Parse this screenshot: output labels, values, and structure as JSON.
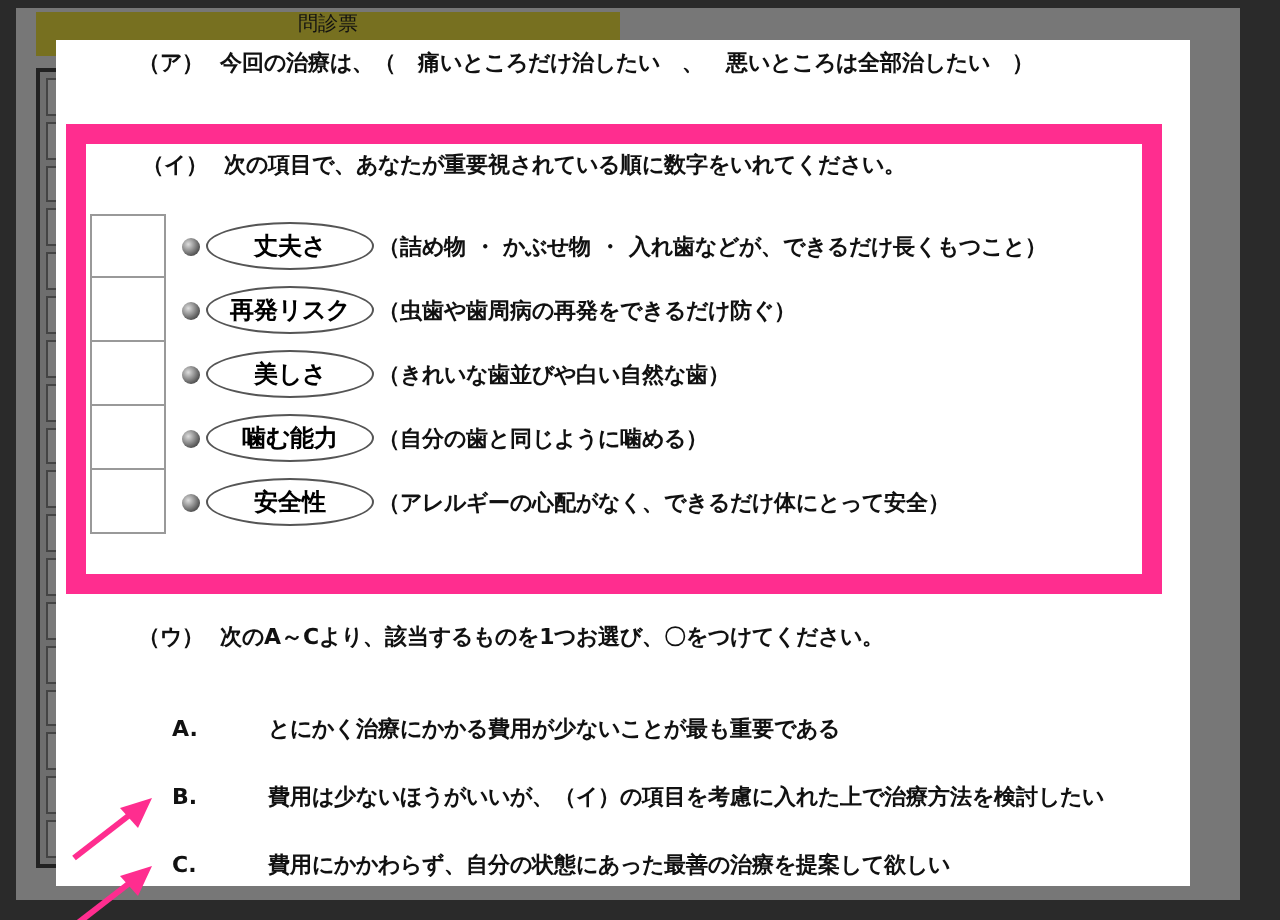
{
  "background_page": {
    "title": "問診票"
  },
  "lightbox": {
    "question_a": {
      "label": "（ア）",
      "text": "今回の治療は、（　痛いところだけ治したい　、　悪いところは全部治したい　）"
    },
    "question_b": {
      "label": "（イ）",
      "text": "次の項目で、あなたが重要視されている順に数字をいれてください。",
      "items": [
        {
          "label": "丈夫さ",
          "description": "（詰め物 ・ かぶせ物 ・ 入れ歯などが、できるだけ長くもつこと）"
        },
        {
          "label": "再発リスク",
          "description": "（虫歯や歯周病の再発をできるだけ防ぐ）"
        },
        {
          "label": "美しさ",
          "description": "（きれいな歯並びや白い自然な歯）"
        },
        {
          "label": "噛む能力",
          "description": "（自分の歯と同じように噛める）"
        },
        {
          "label": "安全性",
          "description": "（アレルギーの心配がなく、できるだけ体にとって安全）"
        }
      ]
    },
    "question_c": {
      "label": "（ウ）",
      "text": "次のA～Cより、該当するものを1つお選び、〇をつけてください。",
      "options": [
        {
          "letter": "A.",
          "text": "とにかく治療にかかる費用が少ないことが最も重要である",
          "highlighted": false
        },
        {
          "letter": "B.",
          "text": "費用は少ないほうがいいが、（イ）の項目を考慮に入れた上で治療方法を検討したい",
          "highlighted": true
        },
        {
          "letter": "C.",
          "text": "費用にかかわらず、自分の状態にあった最善の治療を提案して欲しい",
          "highlighted": true
        }
      ]
    }
  }
}
